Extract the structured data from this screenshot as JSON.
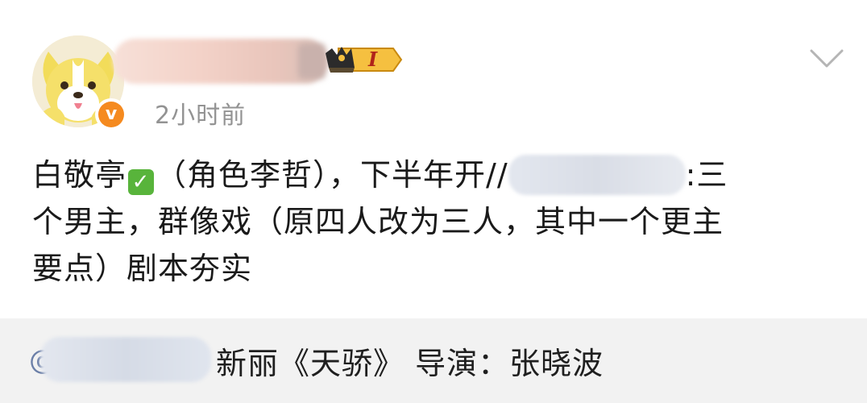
{
  "post": {
    "timestamp": "2小时前",
    "content_lines": {
      "l1_a": "白敬亭",
      "l1_b": "（角色李哲），下半年开//",
      "l1_c": ":三",
      "l2": "个男主，群像戏（原四人改为三人，其中一个更主",
      "l3": "要点）剧本夯实"
    },
    "level_badge": "I",
    "verified_mark": "v"
  },
  "retweet": {
    "at_symbol": "@",
    "text": "新丽《天骄》 导演：张晓波"
  },
  "icons": {
    "avatar": "dog-avatar-icon",
    "verified": "verified-badge-icon",
    "level": "crown-level-badge-icon",
    "more": "chevron-down-icon",
    "check": "check-mark-emoji-icon"
  },
  "colors": {
    "verified_orange": "#f58a1f",
    "time_gray": "#939393",
    "retweet_bg": "#f2f2f2",
    "badge_gold": "#f5c040"
  }
}
